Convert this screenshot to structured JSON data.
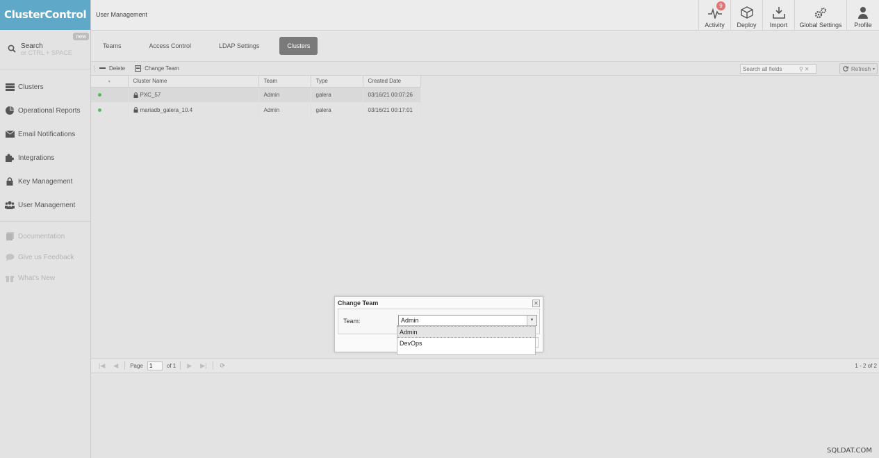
{
  "app": {
    "logo": "ClusterControl",
    "page_title": "User Management"
  },
  "search": {
    "label": "Search",
    "hint": "or CTRL + SPACE",
    "badge": "new"
  },
  "sidebar": {
    "items": [
      {
        "label": "Clusters",
        "icon": "clusters-icon"
      },
      {
        "label": "Operational Reports",
        "icon": "pie-chart-icon"
      },
      {
        "label": "Email Notifications",
        "icon": "envelope-icon"
      },
      {
        "label": "Integrations",
        "icon": "puzzle-icon"
      },
      {
        "label": "Key Management",
        "icon": "lock-icon"
      },
      {
        "label": "User Management",
        "icon": "users-icon"
      }
    ],
    "secondary": [
      {
        "label": "Documentation",
        "icon": "book-icon"
      },
      {
        "label": "Give us Feedback",
        "icon": "chat-icon"
      },
      {
        "label": "What's New",
        "icon": "gift-icon"
      }
    ]
  },
  "topbar": {
    "actions": [
      {
        "label": "Activity",
        "icon": "activity-icon",
        "badge": "9"
      },
      {
        "label": "Deploy",
        "icon": "cube-icon"
      },
      {
        "label": "Import",
        "icon": "import-icon"
      },
      {
        "label": "Global Settings",
        "icon": "gears-icon"
      },
      {
        "label": "Profile",
        "icon": "user-icon"
      }
    ]
  },
  "tabs": [
    {
      "label": "Teams"
    },
    {
      "label": "Access Control"
    },
    {
      "label": "LDAP Settings"
    },
    {
      "label": "Clusters",
      "active": true
    }
  ],
  "toolbar": {
    "delete_label": "Delete",
    "change_team_label": "Change Team",
    "search_placeholder": "Search all fields",
    "refresh_label": "Refresh"
  },
  "grid": {
    "columns": [
      "Cluster Name",
      "Team",
      "Type",
      "Created Date"
    ],
    "rows": [
      {
        "name": "PXC_57",
        "team": "Admin",
        "type": "galera",
        "created": "03/16/21 00:07:26"
      },
      {
        "name": "mariadb_galera_10.4",
        "team": "Admin",
        "type": "galera",
        "created": "03/16/21 00:17:01"
      }
    ]
  },
  "pager": {
    "page_label": "Page",
    "page_value": "1",
    "of_label": "of 1",
    "count": "1 - 2 of 2"
  },
  "dialog": {
    "title": "Change Team",
    "team_label": "Team:",
    "team_value": "Admin",
    "options": [
      "Admin",
      "DevOps"
    ]
  },
  "watermark": "SQLDAT.COM",
  "colors": {
    "logo_bg": "#5fa8c7",
    "active_tab": "#7a7a7a",
    "status_ok": "#5cb85c",
    "notif": "#e57373"
  }
}
